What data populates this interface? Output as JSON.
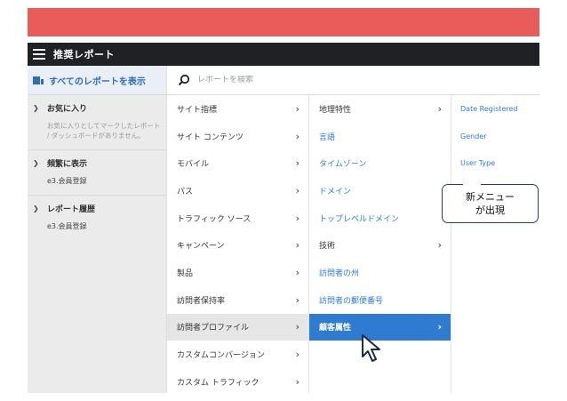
{
  "header": {
    "title": "推奨レポート"
  },
  "subbar": {
    "show_all_label": "すべてのレポートを表示",
    "search_placeholder": "レポートを検索"
  },
  "sidebar": {
    "favorites": {
      "label": "お気に入り",
      "description": "お気に入りとしてマークしたレポート / ダッシュボードがありません。"
    },
    "frequent": {
      "label": "頻繁に表示",
      "items": [
        "e3.会員登録"
      ]
    },
    "history": {
      "label": "レポート履歴",
      "items": [
        "e3.会員登録"
      ]
    }
  },
  "column1": {
    "items": [
      {
        "label": "サイト指標",
        "has_arrow": true
      },
      {
        "label": "サイト コンテンツ",
        "has_arrow": true
      },
      {
        "label": "モバイル",
        "has_arrow": true
      },
      {
        "label": "パス",
        "has_arrow": true
      },
      {
        "label": "トラフィック ソース",
        "has_arrow": true
      },
      {
        "label": "キャンペーン",
        "has_arrow": true
      },
      {
        "label": "製品",
        "has_arrow": true
      },
      {
        "label": "訪問者保持率",
        "has_arrow": true
      },
      {
        "label": "訪問者プロファイル",
        "has_arrow": true,
        "hover": true
      },
      {
        "label": "カスタムコンバージョン",
        "has_arrow": true
      },
      {
        "label": "カスタム トラフィック",
        "has_arrow": true
      }
    ]
  },
  "column2": {
    "items": [
      {
        "label": "地理特性",
        "has_arrow": true,
        "link": false
      },
      {
        "label": "言語",
        "has_arrow": false,
        "link": true
      },
      {
        "label": "タイムゾーン",
        "has_arrow": false,
        "link": true
      },
      {
        "label": "ドメイン",
        "has_arrow": false,
        "link": true
      },
      {
        "label": "トップレベルドメイン",
        "has_arrow": false,
        "link": true
      },
      {
        "label": "技術",
        "has_arrow": true,
        "link": false
      },
      {
        "label": "訪問者の州",
        "has_arrow": false,
        "link": true
      },
      {
        "label": "訪問者の郵便番号",
        "has_arrow": false,
        "link": true
      },
      {
        "label": "顧客属性",
        "has_arrow": true,
        "link": false,
        "active": true
      }
    ]
  },
  "column3": {
    "items": [
      "Date Registered",
      "Gender",
      "User Type"
    ]
  },
  "callout": {
    "line1": "新メニュー",
    "line2": "が出現"
  },
  "colors": {
    "top_bar": "#e85c59",
    "header": "#202124",
    "accent_blue": "#2f7bd0",
    "callout_border": "#2a3e6b"
  },
  "icons": {
    "menu": "hamburger-icon",
    "reports": "report-icon",
    "search": "search-icon",
    "cursor": "mouse-cursor-icon"
  }
}
